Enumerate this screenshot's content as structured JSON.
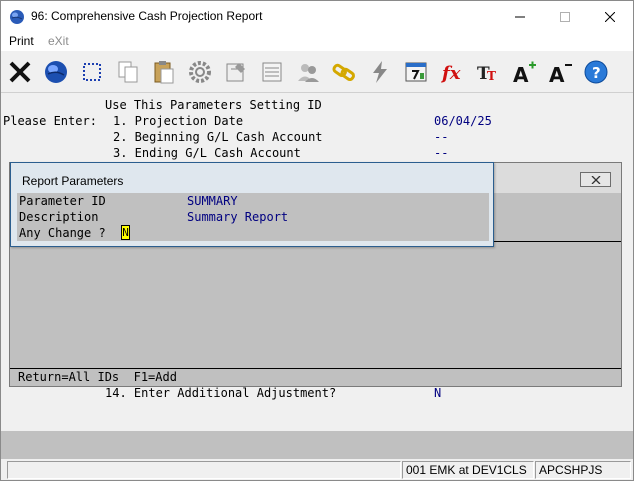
{
  "window": {
    "title": "96: Comprehensive Cash Projection Report"
  },
  "menu": {
    "print": "Print",
    "exit": "eXit"
  },
  "toolbar": {
    "buttons": [
      "close-icon",
      "globe-icon",
      "select-icon",
      "copy-icon",
      "paste-icon",
      "settings-icon",
      "form-icon",
      "list-icon",
      "users-icon",
      "link-icon",
      "lightning-icon",
      "calculator-icon",
      "function-icon",
      "text-size-icon",
      "font-increase-icon",
      "font-decrease-icon",
      "help-icon"
    ]
  },
  "screen": {
    "line_setting": "Use This Parameters Setting ID",
    "please_enter": "Please Enter:",
    "item1": "1. Projection Date",
    "item1_value": "06/04/25",
    "item2": "2. Beginning G/L Cash Account",
    "item2_value": "--",
    "item3": "3. Ending G/L Cash Account",
    "item3_value": "--",
    "item14": "14. Enter Additional Adjustment?",
    "item14_value": "N"
  },
  "dialog": {
    "title": "Report Parameters",
    "param_id_label": "Parameter ID",
    "param_id_value": "SUMMARY",
    "description_label": "Description",
    "description_value": "Summary Report",
    "any_change_label": "Any Change ?",
    "any_change_value": "N"
  },
  "hint": {
    "text": "Return=All IDs  F1=Add"
  },
  "statusbar": {
    "user": "001 EMK at DEV1CLS",
    "program": "APCSHPJS"
  },
  "colors": {
    "value_text": "#000080",
    "input_highlight": "#ffff00",
    "panel_gray": "#c0c0c0",
    "dialog_border": "#2b5e8f"
  }
}
